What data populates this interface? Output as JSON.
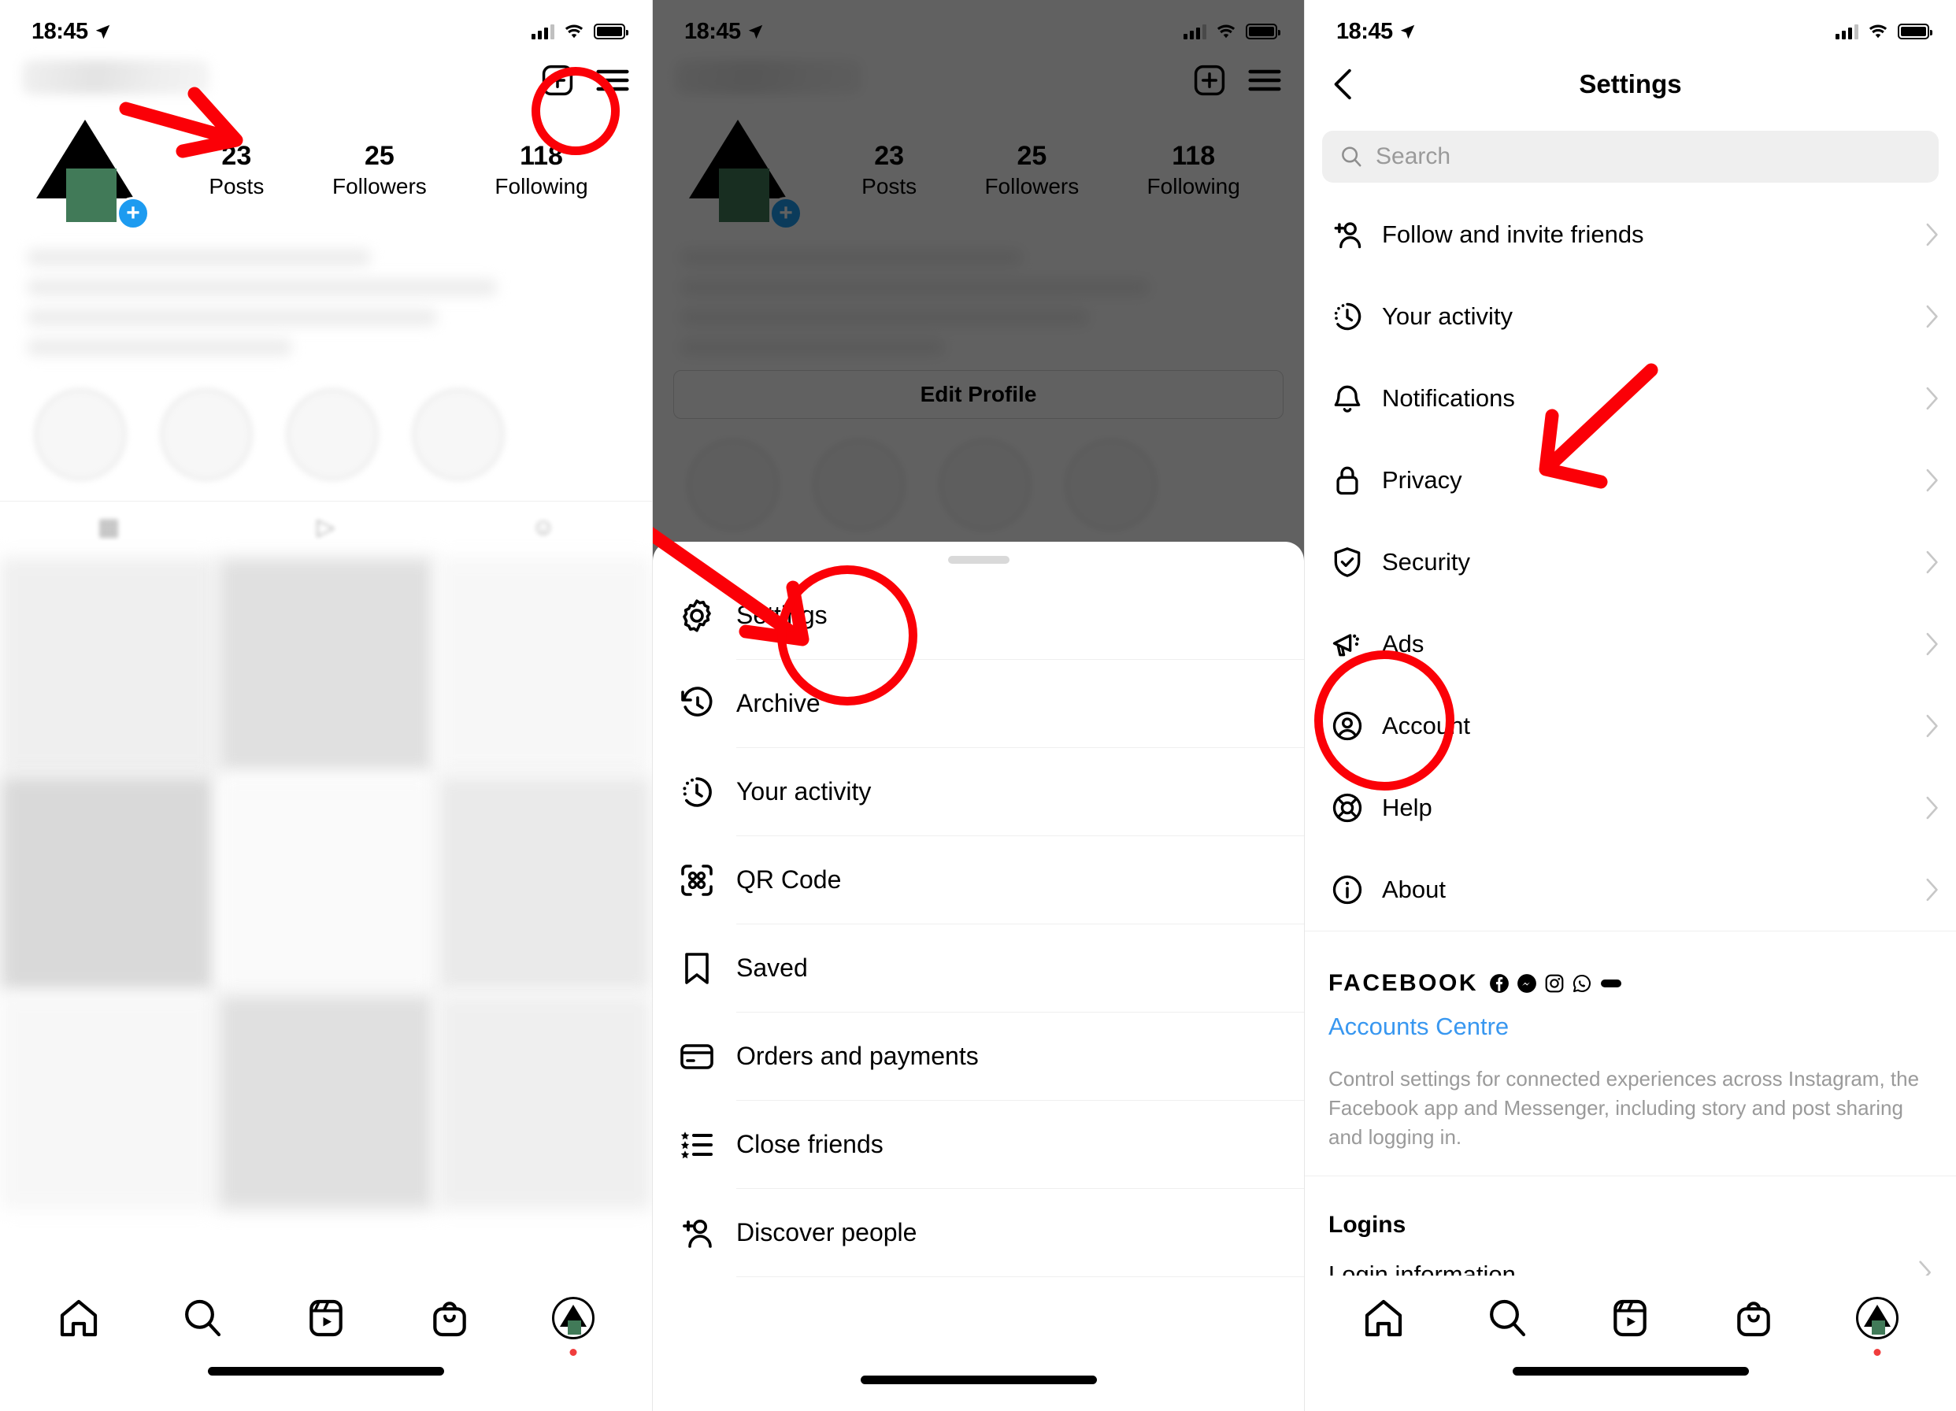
{
  "status_bar": {
    "time": "18:45",
    "location_icon": "location-arrow-icon",
    "signal_icon": "cellular-bars-icon",
    "wifi_icon": "wifi-icon",
    "battery_icon": "battery-icon"
  },
  "profile": {
    "stats": [
      {
        "value": "23",
        "label": "Posts"
      },
      {
        "value": "25",
        "label": "Followers"
      },
      {
        "value": "118",
        "label": "Following"
      }
    ],
    "edit_profile_label": "Edit Profile",
    "avatar_icon": "profile-avatar",
    "add_story_icon": "plus-badge-icon",
    "new_post_icon": "new-post-icon",
    "menu_icon": "hamburger-menu-icon"
  },
  "bottom_nav": {
    "items": [
      {
        "icon": "home-icon",
        "name": "home"
      },
      {
        "icon": "search-icon",
        "name": "search"
      },
      {
        "icon": "reels-icon",
        "name": "reels"
      },
      {
        "icon": "shop-bag-icon",
        "name": "shop"
      },
      {
        "icon": "profile-avatar-icon",
        "name": "profile"
      }
    ]
  },
  "side_sheet": {
    "items": [
      {
        "label": "Settings",
        "icon": "gear-icon"
      },
      {
        "label": "Archive",
        "icon": "archive-clock-icon"
      },
      {
        "label": "Your activity",
        "icon": "activity-clock-icon"
      },
      {
        "label": "QR Code",
        "icon": "qr-code-icon"
      },
      {
        "label": "Saved",
        "icon": "bookmark-icon"
      },
      {
        "label": "Orders and payments",
        "icon": "credit-card-icon"
      },
      {
        "label": "Close friends",
        "icon": "star-list-icon"
      },
      {
        "label": "Discover people",
        "icon": "add-person-icon"
      }
    ]
  },
  "settings_screen": {
    "title": "Settings",
    "back_icon": "chevron-left-icon",
    "search": {
      "placeholder": "Search",
      "icon": "search-icon"
    },
    "items": [
      {
        "label": "Follow and invite friends",
        "icon": "add-person-icon"
      },
      {
        "label": "Your activity",
        "icon": "activity-clock-icon"
      },
      {
        "label": "Notifications",
        "icon": "bell-icon"
      },
      {
        "label": "Privacy",
        "icon": "lock-icon"
      },
      {
        "label": "Security",
        "icon": "shield-check-icon"
      },
      {
        "label": "Ads",
        "icon": "megaphone-icon"
      },
      {
        "label": "Account",
        "icon": "account-circle-icon"
      },
      {
        "label": "Help",
        "icon": "lifebuoy-icon"
      },
      {
        "label": "About",
        "icon": "info-circle-icon"
      }
    ],
    "facebook_section": {
      "heading": "FACEBOOK",
      "brand_icons": [
        "facebook-icon",
        "messenger-icon",
        "instagram-icon",
        "whatsapp-icon",
        "oculus-icon"
      ],
      "link": "Accounts Centre",
      "description": "Control settings for connected experiences across Instagram, the Facebook app and Messenger, including story and post sharing and logging in."
    },
    "logins_section": {
      "heading": "Logins",
      "items": [
        {
          "label": "Login information",
          "icon": "chevron-right-icon"
        }
      ]
    }
  },
  "annotations": {
    "color": "#fb0007",
    "marks": [
      {
        "type": "circle",
        "target": "hamburger-menu-icon"
      },
      {
        "type": "arrow",
        "target": "hamburger-menu-icon"
      },
      {
        "type": "circle",
        "target": "settings-menu-item"
      },
      {
        "type": "arrow",
        "target": "settings-menu-item"
      },
      {
        "type": "circle",
        "target": "account-settings-item"
      },
      {
        "type": "arrow",
        "target": "account-settings-item"
      }
    ]
  },
  "colors": {
    "accent_blue": "#3897f0",
    "annotation_red": "#fb0007",
    "avatar_green": "#417a58",
    "dim_overlay": "rgba(0,0,0,0.62)"
  }
}
